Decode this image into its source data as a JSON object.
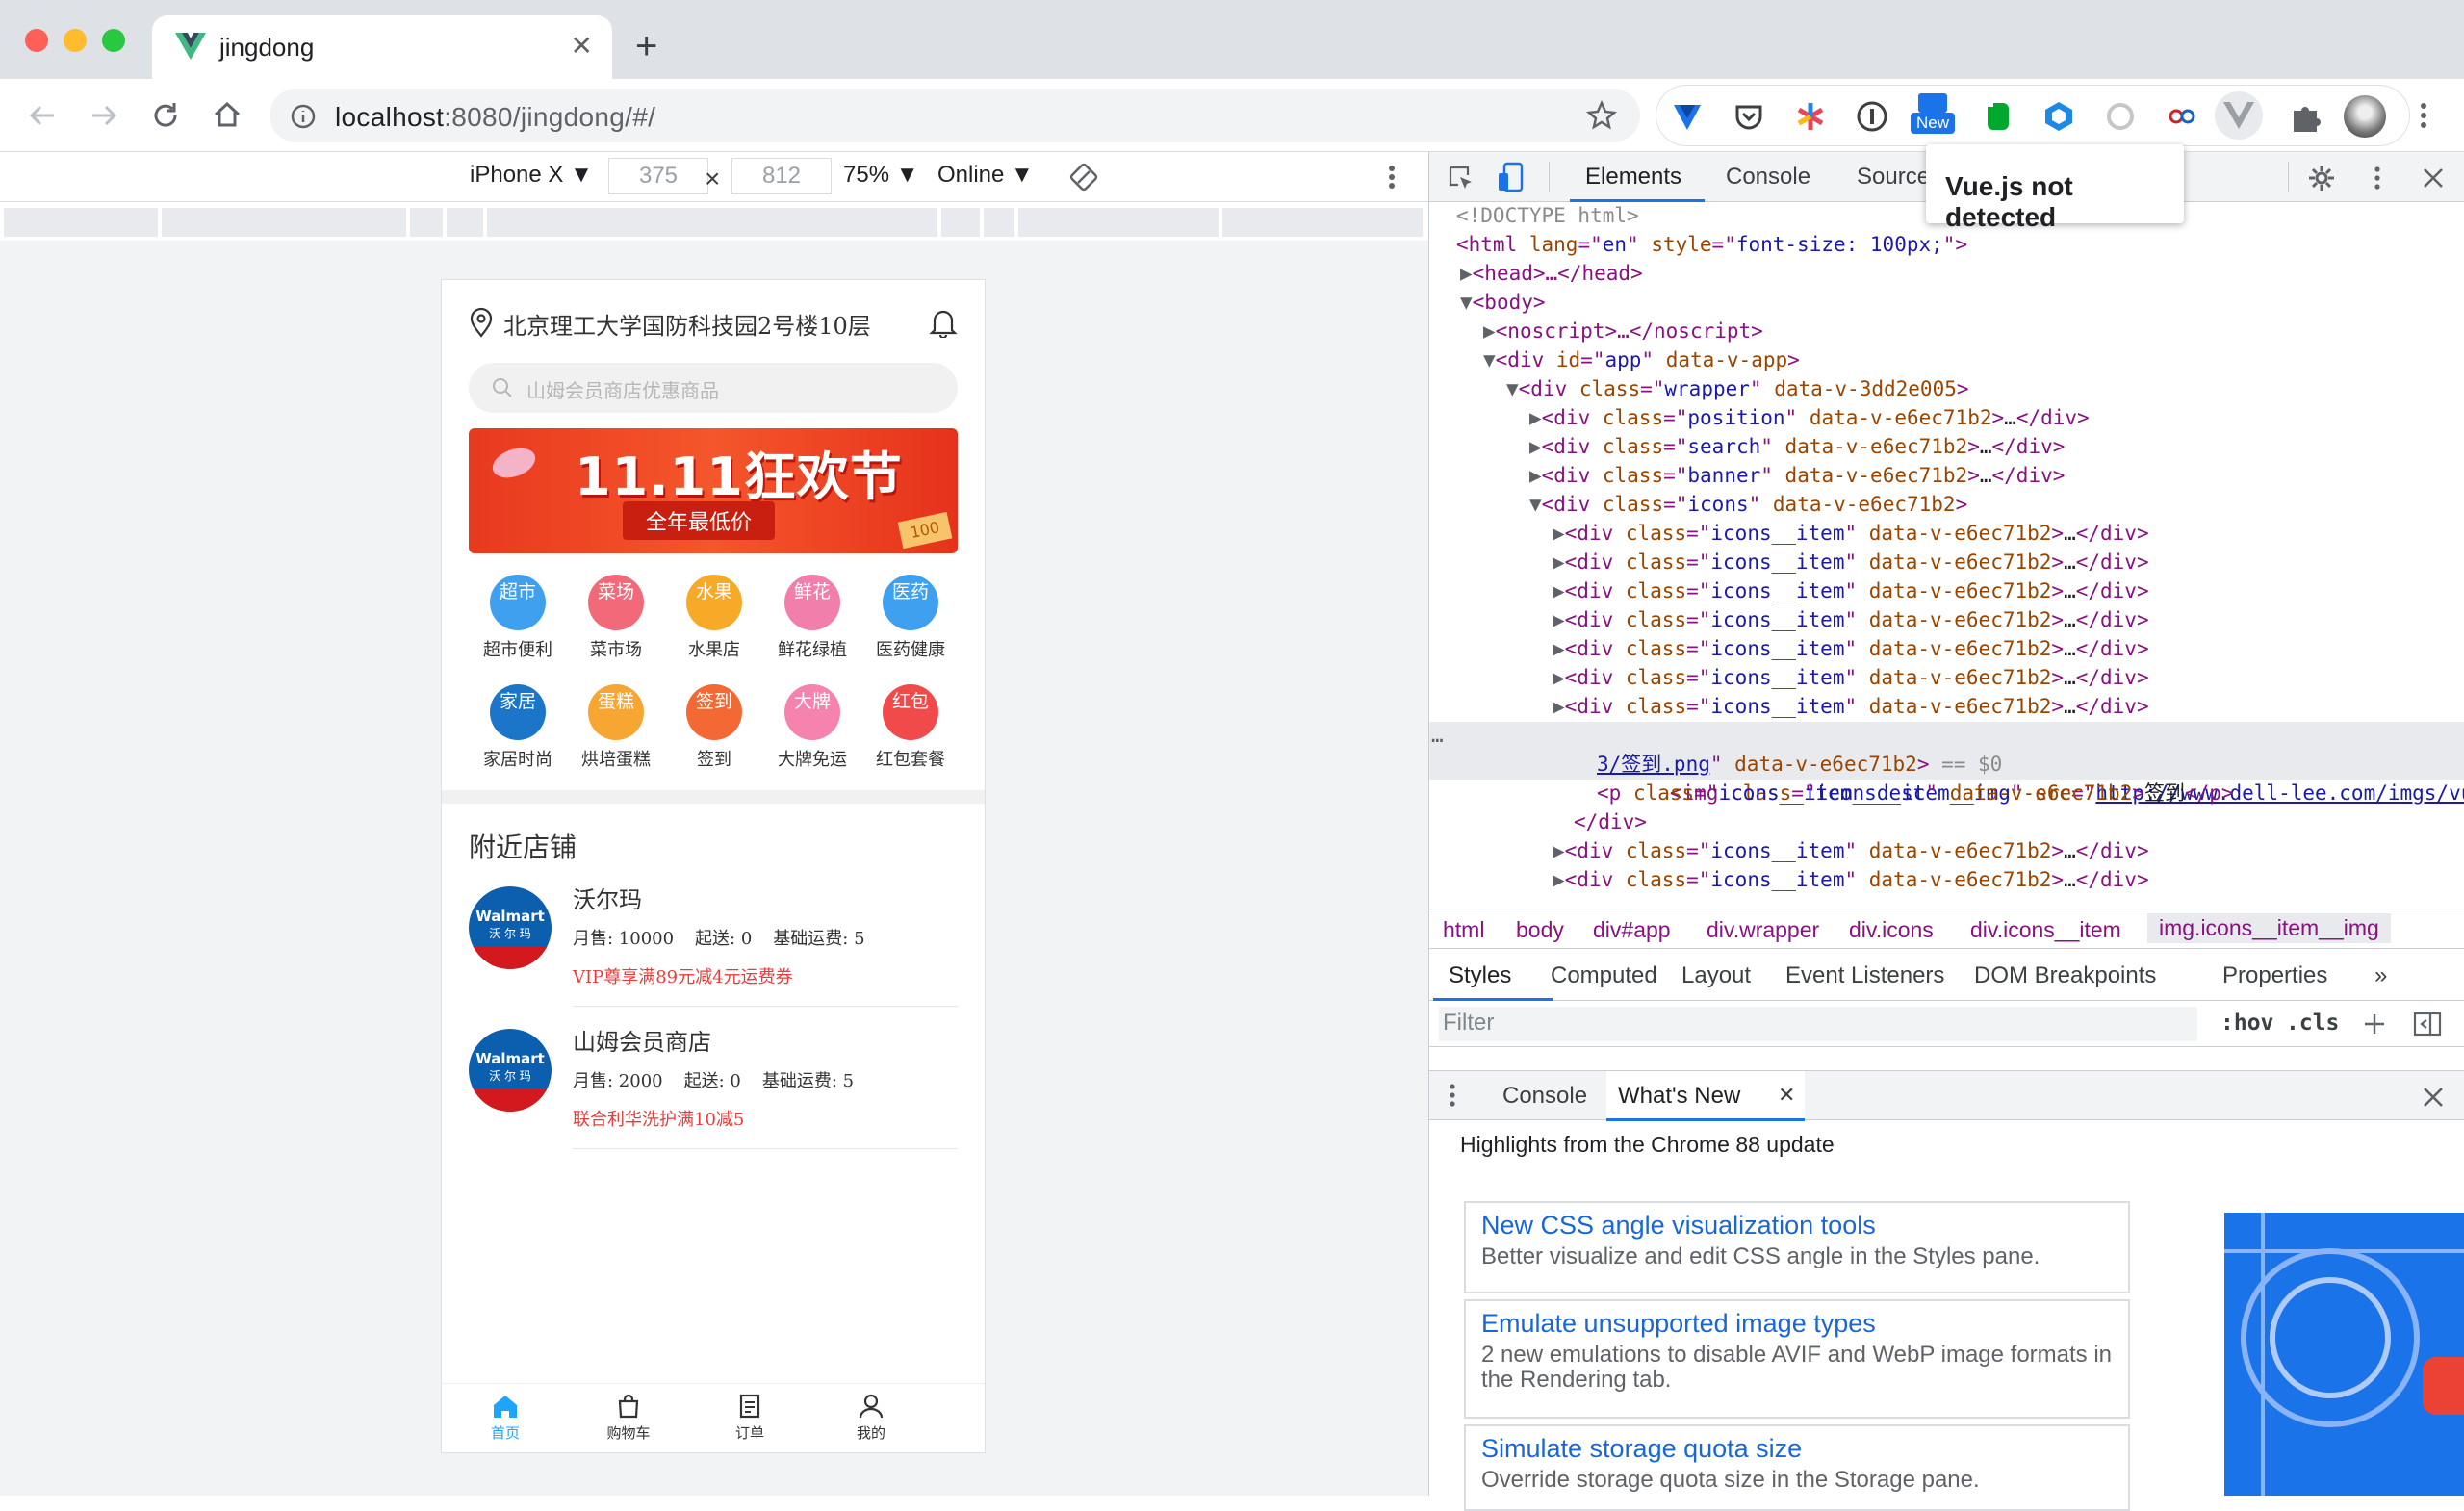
{
  "browser": {
    "tab_title": "jingdong",
    "url_host": "localhost",
    "url_rest": ":8080/jingdong/#/",
    "ext_new_badge": "New"
  },
  "device_toolbar": {
    "device": "iPhone X ▼",
    "width": "375",
    "height": "812",
    "times": "×",
    "zoom": "75% ▼",
    "network": "Online ▼"
  },
  "phone": {
    "location": "北京理工大学国防科技园2号楼10层",
    "search_placeholder": "山姆会员商店优惠商品",
    "banner": {
      "headline": "11.11狂欢节",
      "subline": "全年最低价",
      "tag": "100"
    },
    "icons": [
      {
        "badge": "超市",
        "desc": "超市便利",
        "color": "#3fa0ef"
      },
      {
        "badge": "菜场",
        "desc": "菜市场",
        "color": "#f26a7a"
      },
      {
        "badge": "水果",
        "desc": "水果店",
        "color": "#f7a928"
      },
      {
        "badge": "鲜花",
        "desc": "鲜花绿植",
        "color": "#f27fab"
      },
      {
        "badge": "医药",
        "desc": "医药健康",
        "color": "#3fa0ef"
      },
      {
        "badge": "家居",
        "desc": "家居时尚",
        "color": "#1b76c9"
      },
      {
        "badge": "蛋糕",
        "desc": "烘培蛋糕",
        "color": "#f8a632"
      },
      {
        "badge": "签到",
        "desc": "签到",
        "color": "#f46833"
      },
      {
        "badge": "大牌",
        "desc": "大牌免运",
        "color": "#f682ae"
      },
      {
        "badge": "红包",
        "desc": "红包套餐",
        "color": "#f04a4a"
      }
    ],
    "nearby_title": "附近店铺",
    "shops": [
      {
        "name": "沃尔玛",
        "sales": "月售: 10000",
        "start": "起送: 0",
        "fee": "基础运费: 5",
        "promo": "VIP尊享满89元减4元运费券"
      },
      {
        "name": "山姆会员商店",
        "sales": "月售: 2000",
        "start": "起送: 0",
        "fee": "基础运费: 5",
        "promo": "联合利华洗护满10减5"
      }
    ],
    "logo_en": "Walmart",
    "logo_cn": "沃 尔 玛",
    "dock": [
      "首页",
      "购物车",
      "订单",
      "我的"
    ]
  },
  "devtools": {
    "tabs": [
      "Elements",
      "Console",
      "Sources"
    ],
    "vue_popup": "Vue.js not detected",
    "dom_lines": [
      {
        "i": 0,
        "tri": "",
        "html": "<span class='cm'>&lt;!DOCTYPE html&gt;</span>"
      },
      {
        "i": 0,
        "tri": "",
        "html": "<span class='tag'>&lt;html </span><span class='an'>lang</span><span class='tag'>=\"</span><span class='av'>en</span><span class='tag'>\" </span><span class='an'>style</span><span class='tag'>=\"</span><span class='av'>font-size: 100px;</span><span class='tag'>\"&gt;</span>"
      }
    ],
    "dom_text": {
      "l0": "<!DOCTYPE html>",
      "l1a": "<html ",
      "l1b": "lang",
      "l1c": "=\"",
      "l1d": "en",
      "l1e": "\" ",
      "l1f": "style",
      "l1g": "=\"",
      "l1h": "font-size: 100px;",
      "l1i": "\">",
      "head": "<head>…</head>",
      "body": "<body>",
      "noscript": "<noscript>…</noscript>",
      "app_a": "<div ",
      "app_id": "id",
      "app_v": "app",
      "app_d": "data-v-app",
      "wrap_cls": "wrapper",
      "wrap_d": "data-v-3dd2e005",
      "pos_cls": "position",
      "search_cls": "search",
      "banner_cls": "banner",
      "icons_cls": "icons",
      "dv": "data-v-e6ec71b2",
      "item_cls": "icons__item",
      "img_cls": "icons__item__img",
      "img_src": "http://www.dell-lee.com/imgs/vue3/签到.png",
      "img_src_1": "http://www.dell-lee.com/imgs/vue",
      "img_src_2": "3/签到.png",
      "eq": "== $0",
      "p_cls": "icons__item__desc",
      "p_text": "签到",
      "close_div": "</div>",
      "ellipsis": "…"
    },
    "crumbs": [
      "html",
      "body",
      "div#app",
      "div.wrapper",
      "div.icons",
      "div.icons__item",
      "img.icons__item__img"
    ],
    "style_tabs": [
      "Styles",
      "Computed",
      "Layout",
      "Event Listeners",
      "DOM Breakpoints",
      "Properties",
      "»"
    ],
    "filter_placeholder": "Filter",
    "hov": ":hov",
    "cls": ".cls",
    "drawer_tabs": [
      "Console",
      "What's New"
    ],
    "highlights": "Highlights from the Chrome 88 update",
    "cards": [
      {
        "title": "New CSS angle visualization tools",
        "desc": "Better visualize and edit CSS angle in the Styles pane."
      },
      {
        "title": "Emulate unsupported image types",
        "desc": "2 new emulations to disable AVIF and WebP image formats in the Rendering tab."
      },
      {
        "title": "Simulate storage quota size",
        "desc": "Override storage quota size in the Storage pane."
      }
    ]
  }
}
